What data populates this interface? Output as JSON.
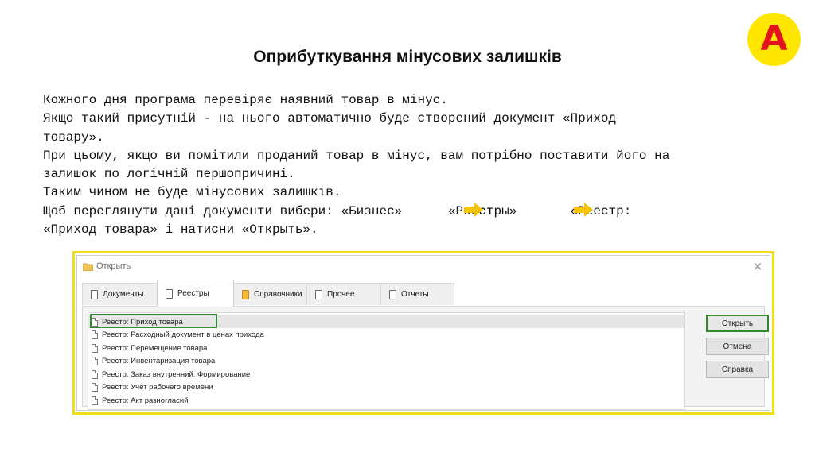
{
  "slide": {
    "logo_letter": "A",
    "title": "Оприбуткування мінусових залишків",
    "lines": [
      "Кожного дня програма перевіряє наявний товар в мінус.",
      "Якщо такий присутній - на нього автоматично буде створений документ «Приход",
      "товару».",
      "При цьому, якщо ви помітили проданий товар в мінус, вам потрібно поставити його на",
      "залишок по логічній першопричині.",
      "Таким чином не буде мінусових залишків.",
      "",
      "Щоб переглянути дані документи вибери: «Бизнес»      «Реестры»       «Реестр:",
      "«Приход товара» і натисни «Открыть»."
    ],
    "colors": {
      "logo_bg": "#ffe600",
      "logo_letter": "#e3141b",
      "dialog_border": "#f0dc1a",
      "highlight": "#2e8b2e",
      "arrow": "#f5c400"
    }
  },
  "dialog": {
    "title": "Открыть",
    "close_icon": "×",
    "tabs": [
      {
        "label": "Документы",
        "icon": "document-icon"
      },
      {
        "label": "Реестры",
        "icon": "document-icon"
      },
      {
        "label": "Справочники",
        "icon": "reference-book-icon"
      },
      {
        "label": "Прочее",
        "icon": "copy-icon"
      },
      {
        "label": "Отчеты",
        "icon": "report-icon"
      }
    ],
    "active_tab": "Реестры",
    "items": [
      "Реестр: Приход товара",
      "Реестр: Расходный документ в ценах прихода",
      "Реестр: Перемещение товара",
      "Реестр: Инвентаризация товара",
      "Реестр: Заказ внутренний: Формирование",
      "Реестр: Учет рабочего времени",
      "Реестр: Акт разногласий"
    ],
    "selected_item": "Реестр: Приход товара",
    "buttons": {
      "open": "Открыть",
      "cancel": "Отмена",
      "help": "Справка"
    }
  }
}
